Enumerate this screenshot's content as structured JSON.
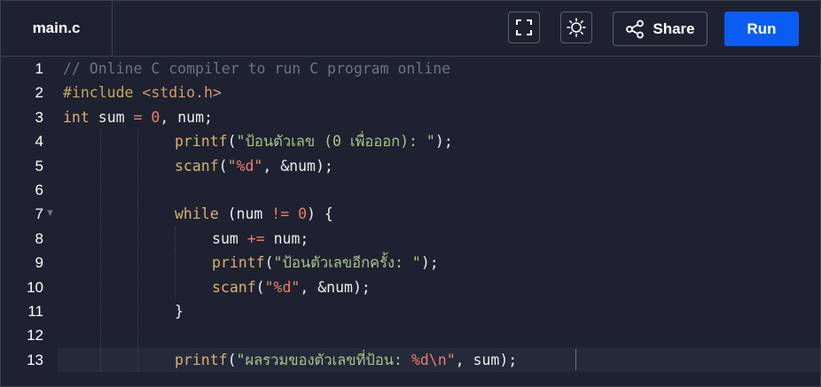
{
  "tab": {
    "label": "main.c"
  },
  "toolbar": {
    "fullscreen_icon": "fullscreen-icon",
    "theme_icon": "sun-icon",
    "share_icon": "share-icon",
    "share_label": "Share",
    "run_label": "Run"
  },
  "colors": {
    "background": "#1e2230",
    "run_button": "#0a5cf5",
    "border": "#3a3f4c"
  },
  "editor": {
    "active_line": 13,
    "lines": [
      {
        "n": "1",
        "text": "// Online C compiler to run C program online"
      },
      {
        "n": "2",
        "text": "#include <stdio.h>"
      },
      {
        "n": "3",
        "text": "int sum = 0, num;"
      },
      {
        "n": "4",
        "text": "printf(\"ป้อนตัวเลข (0 เพื่อออก): \");"
      },
      {
        "n": "5",
        "text": "scanf(\"%d\", &num);"
      },
      {
        "n": "6",
        "text": ""
      },
      {
        "n": "7",
        "text": "while (num != 0) {"
      },
      {
        "n": "8",
        "text": "sum += num;"
      },
      {
        "n": "9",
        "text": "printf(\"ป้อนตัวเลขอีกครั้ง: \");"
      },
      {
        "n": "10",
        "text": "scanf(\"%d\", &num);"
      },
      {
        "n": "11",
        "text": "}"
      },
      {
        "n": "12",
        "text": ""
      },
      {
        "n": "13",
        "text": "printf(\"ผลรวมของตัวเลขที่ป้อน: %d\\n\", sum);"
      }
    ]
  }
}
